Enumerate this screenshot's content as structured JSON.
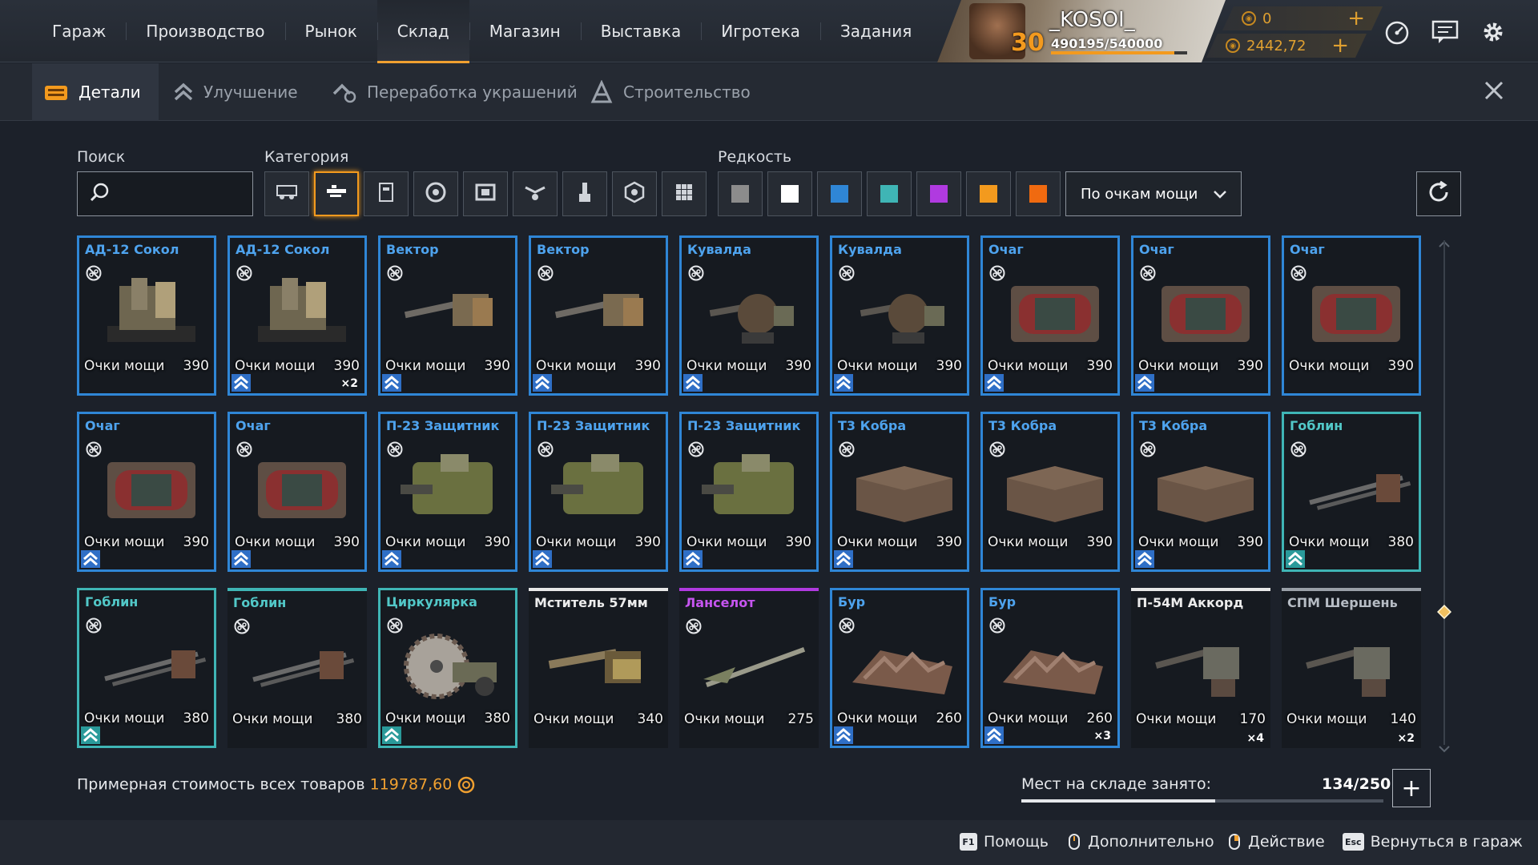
{
  "nav": {
    "tabs": [
      "Гараж",
      "Производство",
      "Рынок",
      "Склад",
      "Магазин",
      "Выставка",
      "Игротека",
      "Задания"
    ],
    "active_index": 3
  },
  "player": {
    "name": "_KOSOI_",
    "level": "30",
    "xp": "490195/540000",
    "xp_fraction": 0.908
  },
  "currency": {
    "coins": "0",
    "credits": "2442,72"
  },
  "subtabs": [
    {
      "label": "Детали",
      "icon": "crate-icon",
      "active": true
    },
    {
      "label": "Улучшение",
      "icon": "upgrade-chevrons-icon",
      "active": false
    },
    {
      "label": "Переработка украшений",
      "icon": "recycle-icon",
      "active": false
    },
    {
      "label": "Строительство",
      "icon": "construction-icon",
      "active": false
    }
  ],
  "filters": {
    "search_label": "Поиск",
    "search_placeholder": "",
    "category_label": "Категория",
    "categories": [
      "cabin-icon",
      "weapon-icon",
      "module-icon",
      "wheel-icon",
      "frame-icon",
      "decor-icon",
      "paint-icon",
      "engine-icon",
      "grid-icon"
    ],
    "active_category": 1,
    "rarity_label": "Редкость",
    "rarity_colors": [
      "#8c8c8c",
      "#ffffff",
      "#2f86d6",
      "#3fb5b5",
      "#b03ae0",
      "#f39a1e",
      "#f06a10"
    ],
    "sort_value": "По очкам мощи"
  },
  "items": [
    {
      "name": "АД-12 Сокол",
      "rarity": "blue",
      "power_label": "Очки мощи",
      "power": "390",
      "art": "turret",
      "upgrade": false,
      "qty": ""
    },
    {
      "name": "АД-12 Сокол",
      "rarity": "blue",
      "power_label": "Очки мощи",
      "power": "390",
      "art": "turret",
      "upgrade": true,
      "qty": "×2"
    },
    {
      "name": "Вектор",
      "rarity": "blue",
      "power_label": "Очки мощи",
      "power": "390",
      "art": "gun",
      "upgrade": true,
      "qty": ""
    },
    {
      "name": "Вектор",
      "rarity": "blue",
      "power_label": "Очки мощи",
      "power": "390",
      "art": "gun",
      "upgrade": true,
      "qty": ""
    },
    {
      "name": "Кувалда",
      "rarity": "blue",
      "power_label": "Очки мощи",
      "power": "390",
      "art": "cannon",
      "upgrade": true,
      "qty": ""
    },
    {
      "name": "Кувалда",
      "rarity": "blue",
      "power_label": "Очки мощи",
      "power": "390",
      "art": "cannon",
      "upgrade": true,
      "qty": ""
    },
    {
      "name": "Очаг",
      "rarity": "blue",
      "power_label": "Очки мощи",
      "power": "390",
      "art": "barrel",
      "upgrade": true,
      "qty": ""
    },
    {
      "name": "Очаг",
      "rarity": "blue",
      "power_label": "Очки мощи",
      "power": "390",
      "art": "barrel",
      "upgrade": true,
      "qty": ""
    },
    {
      "name": "Очаг",
      "rarity": "blue",
      "power_label": "Очки мощи",
      "power": "390",
      "art": "barrel",
      "upgrade": false,
      "qty": ""
    },
    {
      "name": "Очаг",
      "rarity": "blue",
      "power_label": "Очки мощи",
      "power": "390",
      "art": "barrel",
      "upgrade": true,
      "qty": ""
    },
    {
      "name": "Очаг",
      "rarity": "blue",
      "power_label": "Очки мощи",
      "power": "390",
      "art": "barrel",
      "upgrade": true,
      "qty": ""
    },
    {
      "name": "П-23 Защитник",
      "rarity": "blue",
      "power_label": "Очки мощи",
      "power": "390",
      "art": "drum",
      "upgrade": true,
      "qty": ""
    },
    {
      "name": "П-23 Защитник",
      "rarity": "blue",
      "power_label": "Очки мощи",
      "power": "390",
      "art": "drum",
      "upgrade": true,
      "qty": ""
    },
    {
      "name": "П-23 Защитник",
      "rarity": "blue",
      "power_label": "Очки мощи",
      "power": "390",
      "art": "drum",
      "upgrade": true,
      "qty": ""
    },
    {
      "name": "Т3 Кобра",
      "rarity": "blue",
      "power_label": "Очки мощи",
      "power": "390",
      "art": "box",
      "upgrade": true,
      "qty": ""
    },
    {
      "name": "Т3 Кобра",
      "rarity": "blue",
      "power_label": "Очки мощи",
      "power": "390",
      "art": "box",
      "upgrade": false,
      "qty": ""
    },
    {
      "name": "Т3 Кобра",
      "rarity": "blue",
      "power_label": "Очки мощи",
      "power": "390",
      "art": "box",
      "upgrade": true,
      "qty": ""
    },
    {
      "name": "Гоблин",
      "rarity": "teal",
      "power_label": "Очки мощи",
      "power": "380",
      "art": "spike",
      "upgrade": true,
      "qty": ""
    },
    {
      "name": "Гоблин",
      "rarity": "teal",
      "power_label": "Очки мощи",
      "power": "380",
      "art": "spike",
      "upgrade": true,
      "qty": ""
    },
    {
      "name": "Гоблин",
      "rarity": "teal-top",
      "power_label": "Очки мощи",
      "power": "380",
      "art": "spike",
      "upgrade": false,
      "qty": ""
    },
    {
      "name": "Циркулярка",
      "rarity": "teal",
      "power_label": "Очки мощи",
      "power": "380",
      "art": "saw",
      "upgrade": true,
      "qty": ""
    },
    {
      "name": "Мститель 57мм",
      "rarity": "white",
      "power_label": "Очки мощи",
      "power": "340",
      "art": "artillery",
      "upgrade": false,
      "qty": ""
    },
    {
      "name": "Ланселот",
      "rarity": "purple",
      "power_label": "Очки мощи",
      "power": "275",
      "art": "lance",
      "upgrade": false,
      "qty": ""
    },
    {
      "name": "Бур",
      "rarity": "blue",
      "power_label": "Очки мощи",
      "power": "260",
      "art": "drill",
      "upgrade": true,
      "qty": ""
    },
    {
      "name": "Бур",
      "rarity": "blue",
      "power_label": "Очки мощи",
      "power": "260",
      "art": "drill",
      "upgrade": true,
      "qty": "×3"
    },
    {
      "name": "П-54М Аккорд",
      "rarity": "white",
      "power_label": "Очки мощи",
      "power": "170",
      "art": "mg",
      "upgrade": false,
      "qty": "×4"
    },
    {
      "name": "СПМ Шершень",
      "rarity": "grey",
      "power_label": "Очки мощи",
      "power": "140",
      "art": "mg",
      "upgrade": false,
      "qty": "×2"
    }
  ],
  "footer": {
    "estimate_label": "Примерная стоимость всех товаров",
    "estimate_value": "119787,60",
    "storage_label": "Мест на складе занято:",
    "storage_value": "134/250",
    "storage_fraction": 0.536
  },
  "hints": [
    {
      "key": "F1",
      "label": "Помощь"
    },
    {
      "key": "mouse-left",
      "label": "Дополнительно"
    },
    {
      "key": "mouse-right",
      "label": "Действие"
    },
    {
      "key": "Esc",
      "label": "Вернуться в гараж"
    }
  ]
}
